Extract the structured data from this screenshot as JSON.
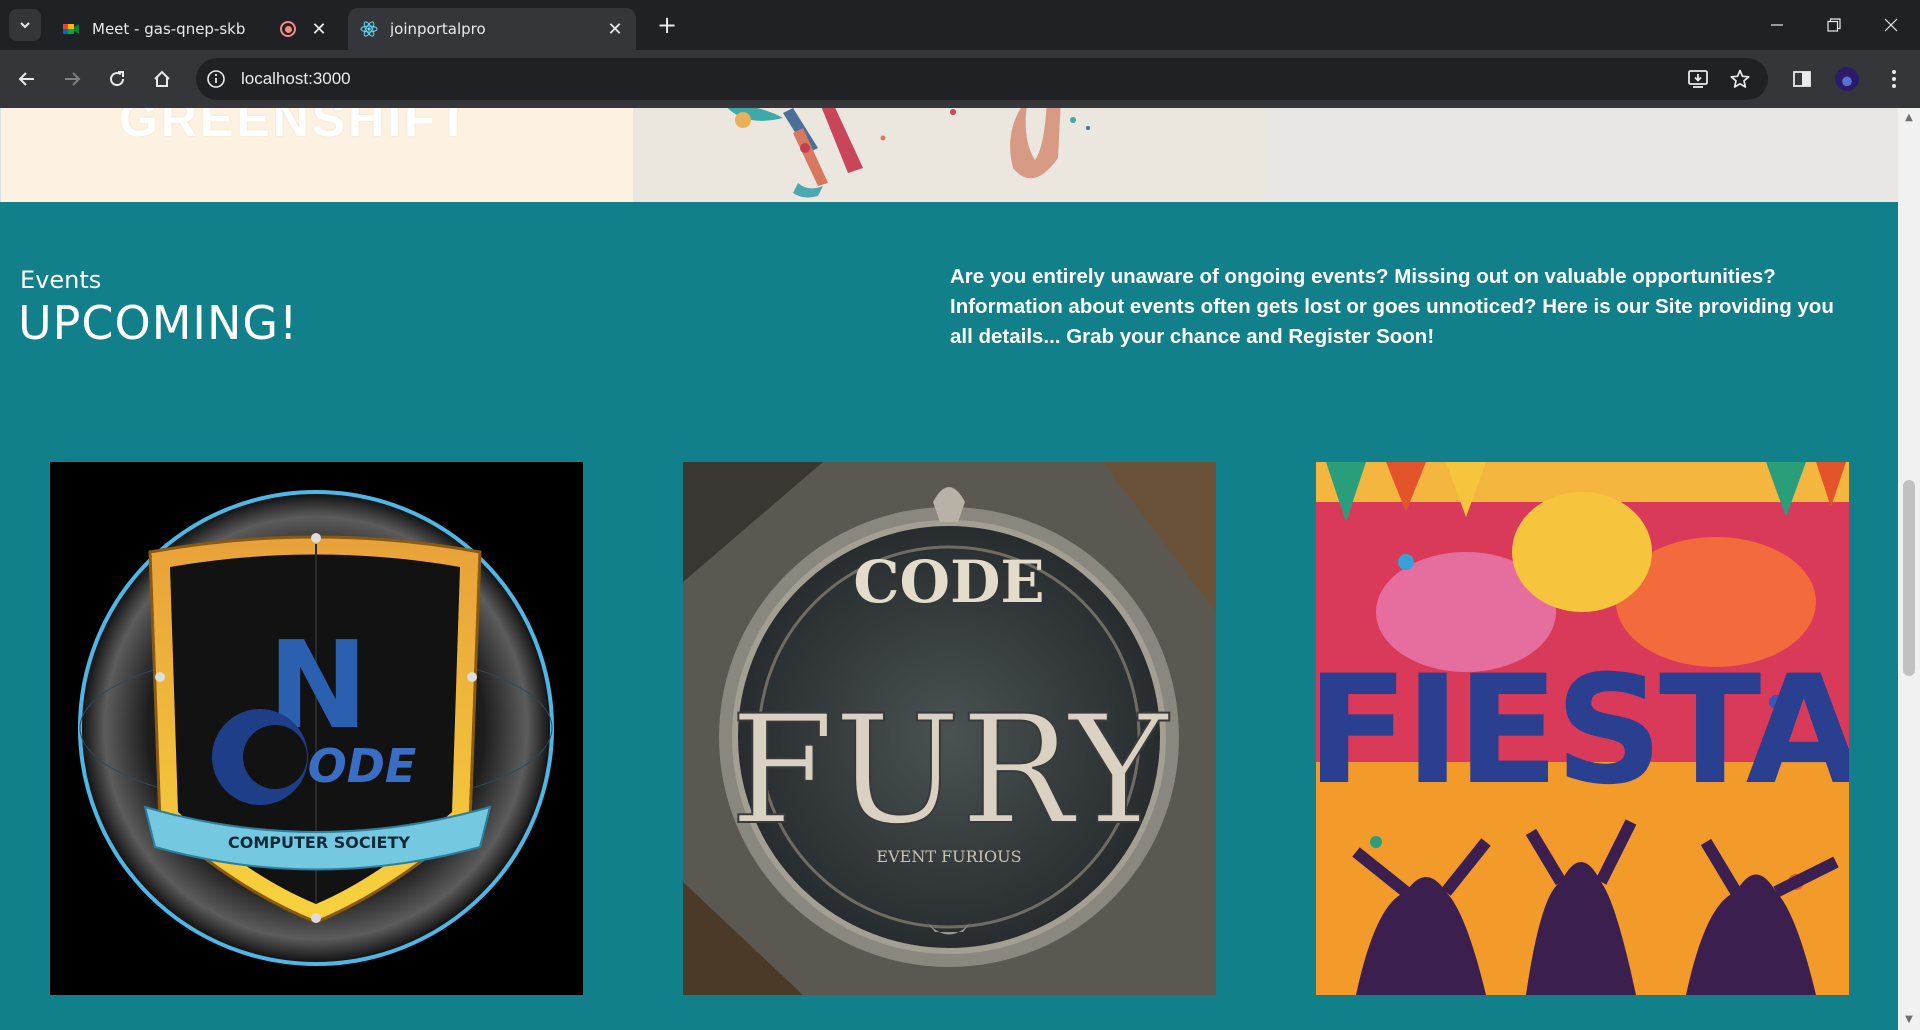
{
  "browser": {
    "tabs": [
      {
        "title": "Meet - gas-qnep-skb",
        "active": false,
        "recording": true
      },
      {
        "title": "joinportalpro",
        "active": true
      }
    ],
    "url": "localhost:3000"
  },
  "gallery": {
    "partial_logo_text": "GREENSHIFT"
  },
  "events": {
    "label": "Events",
    "title": "UPCOMING!",
    "description": "Are you entirely unaware of ongoing events? Missing out on valuable opportunities? Information about events often gets lost or goes unnoticed? Here is our Site providing you all details... Grab your chance and Register Soon!",
    "cards": [
      {
        "name": "NCode",
        "logo_text_top": "N",
        "logo_text_main": "ODE",
        "banner_text": "COMPUTER SOCIETY"
      },
      {
        "name": "Code Fury",
        "line1": "CODE",
        "line2": "FURY",
        "subtitle": "EVENT FURIOUS"
      },
      {
        "name": "Fiesta",
        "text": "FIESTA"
      }
    ]
  },
  "colors": {
    "page_bg": "#11808a",
    "chrome_dark": "#202124",
    "chrome_mid": "#35363a"
  }
}
